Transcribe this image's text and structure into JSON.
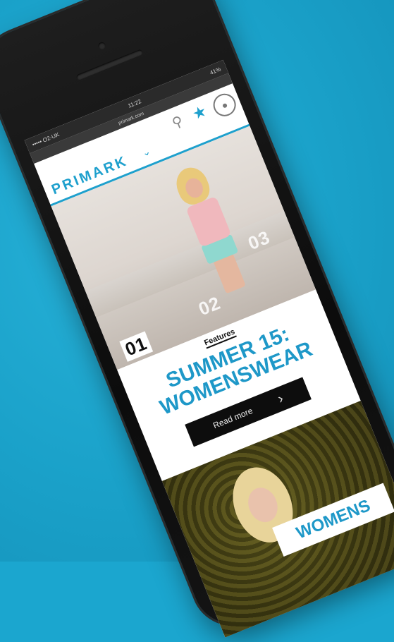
{
  "status_bar": {
    "carrier": "••••• O2-UK",
    "time": "11:22",
    "battery": "41%"
  },
  "url_bar": {
    "text": "primark.com"
  },
  "header": {
    "logo_text": "PRIMARK"
  },
  "hero": {
    "slide_numbers": [
      "01",
      "02",
      "03"
    ]
  },
  "feature": {
    "label": "Features",
    "headline_line1": "SUMMER 15:",
    "headline_line2": "WOMENSWEAR",
    "button_label": "Read more"
  },
  "promo": {
    "label": "WOMENS"
  },
  "colors": {
    "background": "#1ba6cf",
    "accent": "#1e98c8",
    "button": "#0d0d0d"
  }
}
